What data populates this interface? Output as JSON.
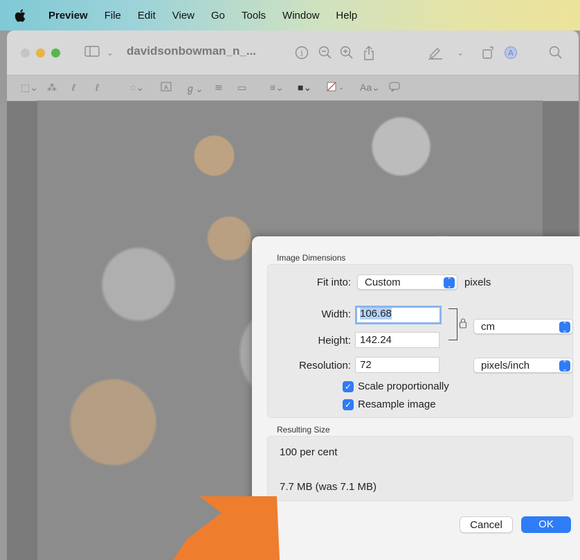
{
  "menubar": {
    "app_name": "Preview",
    "items": [
      "File",
      "Edit",
      "View",
      "Go",
      "Tools",
      "Window",
      "Help"
    ]
  },
  "window": {
    "title": "davidsonbowman_n_..."
  },
  "dialog": {
    "image_dimensions_label": "Image Dimensions",
    "fit_into_label": "Fit into:",
    "fit_into_value": "Custom",
    "fit_into_unit": "pixels",
    "width_label": "Width:",
    "width_value": "106.68",
    "height_label": "Height:",
    "height_value": "142.24",
    "dimension_unit": "cm",
    "resolution_label": "Resolution:",
    "resolution_value": "72",
    "resolution_unit": "pixels/inch",
    "scale_proportionally_label": "Scale proportionally",
    "scale_proportionally_checked": true,
    "resample_image_label": "Resample image",
    "resample_image_checked": true,
    "resulting_size_label": "Resulting Size",
    "percent_text": "100 per cent",
    "size_text": "7.7 MB (was 7.1 MB)",
    "cancel_label": "Cancel",
    "ok_label": "OK"
  },
  "colors": {
    "accent": "#2f7cf6",
    "annotation_arrow": "#ef7d2e"
  }
}
